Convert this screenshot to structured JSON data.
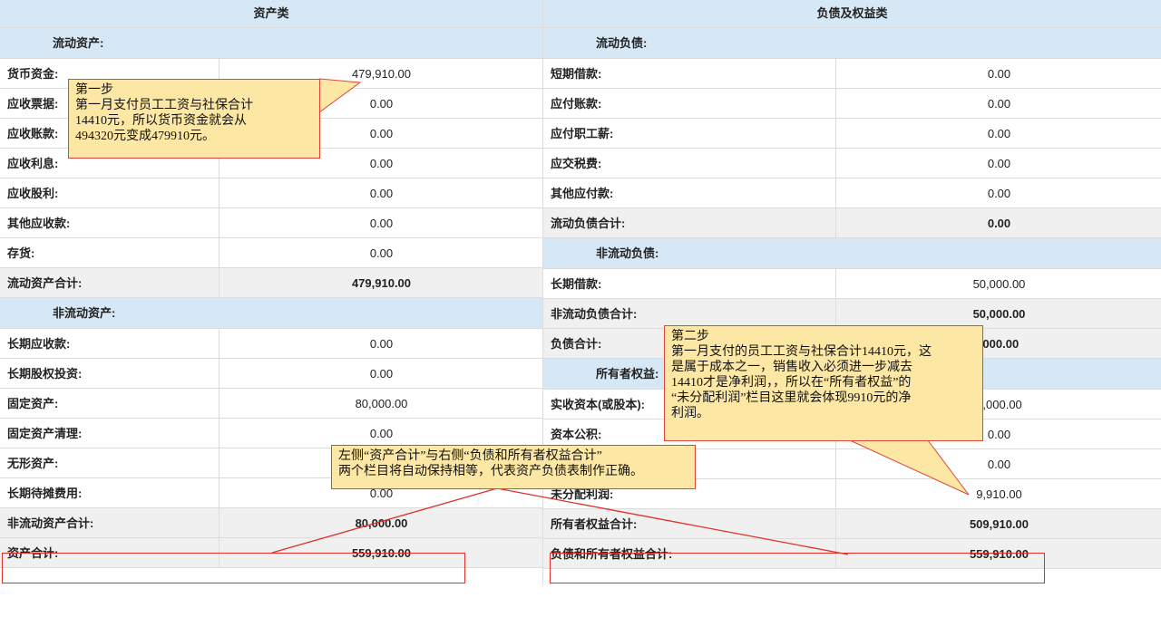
{
  "assets": {
    "header": "资产类",
    "current_section": "流动资产:",
    "current_rows": [
      {
        "label": "货币资金:",
        "value": "479,910.00"
      },
      {
        "label": "应收票据:",
        "value": "0.00"
      },
      {
        "label": "应收账款:",
        "value": "0.00"
      },
      {
        "label": "应收利息:",
        "value": "0.00"
      },
      {
        "label": "应收股利:",
        "value": "0.00"
      },
      {
        "label": "其他应收款:",
        "value": "0.00"
      },
      {
        "label": "存货:",
        "value": "0.00"
      }
    ],
    "current_total": {
      "label": "流动资产合计:",
      "value": "479,910.00"
    },
    "noncurrent_section": "非流动资产:",
    "noncurrent_rows": [
      {
        "label": "长期应收款:",
        "value": "0.00"
      },
      {
        "label": "长期股权投资:",
        "value": "0.00"
      },
      {
        "label": "固定资产:",
        "value": "80,000.00"
      },
      {
        "label": "固定资产清理:",
        "value": "0.00"
      },
      {
        "label": "无形资产:",
        "value": ""
      },
      {
        "label": "长期待摊费用:",
        "value": "0.00"
      }
    ],
    "noncurrent_total": {
      "label": "非流动资产合计:",
      "value": "80,000.00"
    },
    "grand_total": {
      "label": "资产合计:",
      "value": "559,910.00"
    }
  },
  "liabilities": {
    "header": "负债及权益类",
    "current_section": "流动负债:",
    "current_rows": [
      {
        "label": "短期借款:",
        "value": "0.00"
      },
      {
        "label": "应付账款:",
        "value": "0.00"
      },
      {
        "label": "应付职工薪:",
        "value": "0.00"
      },
      {
        "label": "应交税费:",
        "value": "0.00"
      },
      {
        "label": "其他应付款:",
        "value": "0.00"
      }
    ],
    "current_total": {
      "label": "流动负债合计:",
      "value": "0.00"
    },
    "noncurrent_section": "非流动负债:",
    "noncurrent_rows": [
      {
        "label": "长期借款:",
        "value": "50,000.00"
      }
    ],
    "noncurrent_total": {
      "label": "非流动负债合计:",
      "value": "50,000.00"
    },
    "liab_total": {
      "label": "负债合计:",
      "value": ",000.00"
    },
    "equity_section": "所有者权益:",
    "equity_rows": [
      {
        "label": "实收资本(或股本):",
        "value": "0,000.00"
      },
      {
        "label": "资本公积:",
        "value": "0.00"
      },
      {
        "label": "",
        "value": "0.00"
      },
      {
        "label": "未分配利润:",
        "value": "9,910.00"
      }
    ],
    "equity_total": {
      "label": "所有者权益合计:",
      "value": "509,910.00"
    },
    "grand_total": {
      "label": "负债和所有者权益合计:",
      "value": "559,910.00"
    }
  },
  "notes": {
    "step1": "第一步\n第一月支付员工工资与社保合计\n14410元，所以货币资金就会从\n494320元变成479910元。",
    "step2": "第二步\n第一月支付的员工工资与社保合计14410元，这\n是属于成本之一，销售收入必须进一步减去\n14410才是净利润，，所以在“所有者权益”的\n“未分配利润”栏目这里就会体现9910元的净\n利润。",
    "balance": "左侧“资产合计”与右侧“负债和所有者权益合计”\n两个栏目将自动保持相等，代表资产负债表制作正确。"
  }
}
